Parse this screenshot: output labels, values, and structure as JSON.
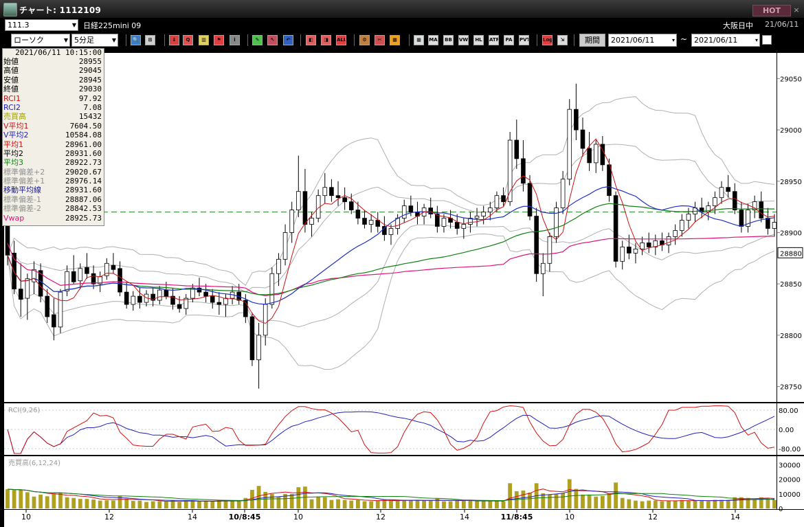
{
  "window": {
    "title": "チャート: 1112109",
    "hot_button": "HOT",
    "close_glyph": "×"
  },
  "toolbar1": {
    "symbol_code": "111.3",
    "symbol_name": "日経225mini 09",
    "session": "大阪日中",
    "session_date": "21/06/11"
  },
  "toolbar2": {
    "chart_type": "ローソク",
    "interval": "5分足",
    "period_button": "期間",
    "date_from": "2021/06/11",
    "date_to": "2021/06/11",
    "tilde": "~",
    "icons": [
      {
        "name": "zoom-icon",
        "label": "🔍",
        "color": "#3a7ec8"
      },
      {
        "name": "split-icon",
        "label": "⊞",
        "color": "#d0d0d0"
      },
      {
        "name": "download-icon",
        "label": "⇓",
        "color": "#d94040"
      },
      {
        "name": "search-chart-icon",
        "label": "Q",
        "color": "#e05050"
      },
      {
        "name": "bar-chart-icon",
        "label": "▥",
        "color": "#e0d060"
      },
      {
        "name": "flag-icon",
        "label": "⚑",
        "color": "#e04040"
      },
      {
        "name": "info-icon",
        "label": "i",
        "color": "#888888"
      },
      {
        "name": "pencil-icon",
        "label": "✎",
        "color": "#50c050"
      },
      {
        "name": "cursor-icon",
        "label": "↖",
        "color": "#c05060"
      },
      {
        "name": "undo-icon",
        "label": "↶",
        "color": "#3060c0"
      },
      {
        "name": "candle-left-icon",
        "label": "◧",
        "color": "#e06060"
      },
      {
        "name": "candle-right-icon",
        "label": "◨",
        "color": "#e06060"
      },
      {
        "name": "all-icon",
        "label": "ALL",
        "color": "#e04040"
      },
      {
        "name": "settings-icon",
        "label": "⚙",
        "color": "#c08040"
      },
      {
        "name": "wrench-icon",
        "label": "✂",
        "color": "#d05050"
      },
      {
        "name": "color-palette-icon",
        "label": "▦",
        "color": "#f0a020"
      },
      {
        "name": "grid-icon",
        "label": "▦",
        "color": "#dddddd"
      },
      {
        "name": "ma-indicator-icon",
        "label": "MA",
        "color": "#dddddd"
      },
      {
        "name": "bb-indicator-icon",
        "label": "BB",
        "color": "#dddddd"
      },
      {
        "name": "vwap-indicator-icon",
        "label": "VWE",
        "color": "#dddddd"
      },
      {
        "name": "hl-indicator-icon",
        "label": "HL",
        "color": "#dddddd"
      },
      {
        "name": "atr-indicator-icon",
        "label": "ATR",
        "color": "#dddddd"
      },
      {
        "name": "pa-indicator-icon",
        "label": "PA",
        "color": "#dddddd"
      },
      {
        "name": "pvt-indicator-icon",
        "label": "PVT",
        "color": "#dddddd"
      },
      {
        "name": "log-scale-icon",
        "label": "Log",
        "color": "#e04040"
      },
      {
        "name": "export-icon",
        "label": "⇲",
        "color": "#dddddd"
      }
    ]
  },
  "info_panel": {
    "datetime": "2021/06/11 10:15:00",
    "rows": [
      {
        "label": "始値",
        "value": "28955",
        "color": "#000000"
      },
      {
        "label": "高値",
        "value": "29045",
        "color": "#000000"
      },
      {
        "label": "安値",
        "value": "28945",
        "color": "#000000"
      },
      {
        "label": "終値",
        "value": "29030",
        "color": "#000000"
      },
      {
        "label": "RCI1",
        "value": "97.92",
        "color": "#d01010"
      },
      {
        "label": "RCI2",
        "value": "7.08",
        "color": "#2020c0"
      },
      {
        "label": "売買高",
        "value": "15432",
        "color": "#a0a000"
      },
      {
        "label": "V平均1",
        "value": "7604.50",
        "color": "#d01010"
      },
      {
        "label": "V平均2",
        "value": "10584.08",
        "color": "#2020c0"
      },
      {
        "label": "平均1",
        "value": "28961.00",
        "color": "#d01010"
      },
      {
        "label": "平均2",
        "value": "28931.60",
        "color": "#000000"
      },
      {
        "label": "平均3",
        "value": "28922.73",
        "color": "#108010"
      },
      {
        "label": "標準偏差+2",
        "value": "29020.67",
        "color": "#909090"
      },
      {
        "label": "標準偏差+1",
        "value": "28976.14",
        "color": "#909090"
      },
      {
        "label": "移動平均線",
        "value": "28931.60",
        "color": "#1a1a90"
      },
      {
        "label": "標準偏差-1",
        "value": "28887.06",
        "color": "#909090"
      },
      {
        "label": "標準偏差-2",
        "value": "28842.53",
        "color": "#909090"
      },
      {
        "label": "Vwap",
        "value": "28925.73",
        "color": "#e0107a"
      }
    ]
  },
  "chart_data": {
    "type": "candlestick",
    "price_axis": {
      "min": 28735,
      "max": 29075,
      "ticks": [
        "29050",
        "29000",
        "28950",
        "28900",
        "28850",
        "28800",
        "28750"
      ],
      "current_price_label": "28880"
    },
    "rci_axis": {
      "label": "RCI(9,26)",
      "ticks": [
        "80.00",
        "0.00",
        "-80.00"
      ]
    },
    "volume_axis": {
      "label": "売買高(6,12,24)",
      "ticks": [
        "30000",
        "20000",
        "10000",
        "0"
      ]
    },
    "x_tick_labels": [
      "10",
      "12",
      "14",
      "10/8:45",
      "10",
      "12",
      "14",
      "11/8:45",
      "10",
      "12",
      "14"
    ],
    "reference_price": 28920,
    "candles": [
      [
        28912,
        28922,
        28868,
        28878
      ],
      [
        28880,
        28892,
        28840,
        28845
      ],
      [
        28845,
        28870,
        28818,
        28835
      ],
      [
        28836,
        28860,
        28815,
        28855
      ],
      [
        28852,
        28872,
        28840,
        28864
      ],
      [
        28863,
        28870,
        28832,
        28838
      ],
      [
        28838,
        28845,
        28812,
        28818
      ],
      [
        28820,
        28836,
        28795,
        28808
      ],
      [
        28808,
        28845,
        28802,
        28842
      ],
      [
        28843,
        28868,
        28838,
        28862
      ],
      [
        28862,
        28878,
        28850,
        28852
      ],
      [
        28853,
        28870,
        28845,
        28865
      ],
      [
        28866,
        28880,
        28855,
        28860
      ],
      [
        28860,
        28868,
        28845,
        28850
      ],
      [
        28850,
        28862,
        28842,
        28857
      ],
      [
        28858,
        28875,
        28854,
        28870
      ],
      [
        28868,
        28880,
        28860,
        28864
      ],
      [
        28865,
        28872,
        28838,
        28842
      ],
      [
        28842,
        28852,
        28826,
        28830
      ],
      [
        28830,
        28843,
        28824,
        28838
      ],
      [
        28838,
        28846,
        28826,
        28832
      ],
      [
        28832,
        28844,
        28828,
        28840
      ],
      [
        28840,
        28846,
        28828,
        28834
      ],
      [
        28834,
        28848,
        28830,
        28844
      ],
      [
        28844,
        28852,
        28835,
        28838
      ],
      [
        28838,
        28846,
        28825,
        28830
      ],
      [
        28830,
        28838,
        28822,
        28826
      ],
      [
        28826,
        28840,
        28820,
        28836
      ],
      [
        28836,
        28850,
        28832,
        28846
      ],
      [
        28846,
        28856,
        28838,
        28842
      ],
      [
        28842,
        28850,
        28832,
        28838
      ],
      [
        28838,
        28845,
        28826,
        28832
      ],
      [
        28832,
        28842,
        28820,
        28830
      ],
      [
        28830,
        28840,
        28818,
        28836
      ],
      [
        28836,
        28848,
        28830,
        28842
      ],
      [
        28842,
        28850,
        28830,
        28834
      ],
      [
        28834,
        28840,
        28812,
        28818
      ],
      [
        28818,
        28822,
        28770,
        28776
      ],
      [
        28776,
        28812,
        28748,
        28800
      ],
      [
        28800,
        28836,
        28790,
        28830
      ],
      [
        28830,
        28866,
        28826,
        28860
      ],
      [
        28860,
        28880,
        28848,
        28874
      ],
      [
        28874,
        28908,
        28868,
        28900
      ],
      [
        28900,
        28930,
        28890,
        28922
      ],
      [
        28922,
        28975,
        28915,
        28940
      ],
      [
        28940,
        28962,
        28900,
        28908
      ],
      [
        28908,
        28920,
        28896,
        28914
      ],
      [
        28914,
        28942,
        28910,
        28936
      ],
      [
        28936,
        28958,
        28928,
        28944
      ],
      [
        28944,
        28952,
        28930,
        28936
      ],
      [
        28936,
        28950,
        28926,
        28934
      ],
      [
        28934,
        28944,
        28922,
        28930
      ],
      [
        28930,
        28938,
        28918,
        28922
      ],
      [
        28922,
        28930,
        28908,
        28914
      ],
      [
        28914,
        28922,
        28904,
        28908
      ],
      [
        28908,
        28918,
        28900,
        28912
      ],
      [
        28912,
        28920,
        28900,
        28906
      ],
      [
        28906,
        28916,
        28892,
        28898
      ],
      [
        28898,
        28908,
        28888,
        28904
      ],
      [
        28904,
        28918,
        28898,
        28914
      ],
      [
        28914,
        28932,
        28910,
        28926
      ],
      [
        28926,
        28936,
        28916,
        28920
      ],
      [
        28920,
        28930,
        28908,
        28916
      ],
      [
        28916,
        28928,
        28908,
        28924
      ],
      [
        28924,
        28934,
        28914,
        28918
      ],
      [
        28918,
        28926,
        28900,
        28906
      ],
      [
        28906,
        28918,
        28900,
        28914
      ],
      [
        28914,
        28922,
        28904,
        28910
      ],
      [
        28910,
        28918,
        28898,
        28904
      ],
      [
        28904,
        28914,
        28894,
        28908
      ],
      [
        28908,
        28920,
        28900,
        28914
      ],
      [
        28914,
        28924,
        28906,
        28916
      ],
      [
        28916,
        28926,
        28908,
        28920
      ],
      [
        28920,
        28930,
        28912,
        28924
      ],
      [
        28924,
        28940,
        28920,
        28936
      ],
      [
        28936,
        28944,
        28926,
        28930
      ],
      [
        28930,
        28998,
        28926,
        28990
      ],
      [
        28990,
        29010,
        28962,
        28972
      ],
      [
        28972,
        28990,
        28940,
        28948
      ],
      [
        28948,
        28956,
        28912,
        28916
      ],
      [
        28916,
        28924,
        28852,
        28860
      ],
      [
        28860,
        28880,
        28838,
        28870
      ],
      [
        28870,
        28900,
        28862,
        28896
      ],
      [
        28896,
        28930,
        28890,
        28924
      ],
      [
        28924,
        28960,
        28918,
        28952
      ],
      [
        28952,
        29030,
        28946,
        29020
      ],
      [
        29020,
        29045,
        28990,
        29000
      ],
      [
        29000,
        29012,
        28974,
        28982
      ],
      [
        28982,
        28998,
        28960,
        28968
      ],
      [
        28968,
        28990,
        28958,
        28986
      ],
      [
        28986,
        28994,
        28960,
        28966
      ],
      [
        28966,
        28972,
        28930,
        28936
      ],
      [
        28936,
        28940,
        28866,
        28872
      ],
      [
        28872,
        28892,
        28864,
        28886
      ],
      [
        28886,
        28898,
        28874,
        28880
      ],
      [
        28880,
        28890,
        28870,
        28884
      ],
      [
        28884,
        28896,
        28878,
        28890
      ],
      [
        28890,
        28900,
        28880,
        28886
      ],
      [
        28886,
        28898,
        28878,
        28892
      ],
      [
        28892,
        28900,
        28882,
        28888
      ],
      [
        28888,
        28900,
        28880,
        28896
      ],
      [
        28896,
        28908,
        28888,
        28902
      ],
      [
        28902,
        28918,
        28896,
        28912
      ],
      [
        28912,
        28924,
        28904,
        28918
      ],
      [
        28918,
        28930,
        28910,
        28924
      ],
      [
        28924,
        28934,
        28914,
        28920
      ],
      [
        28920,
        28930,
        28912,
        28926
      ],
      [
        28926,
        28940,
        28918,
        28934
      ],
      [
        28934,
        28950,
        28928,
        28944
      ],
      [
        28944,
        28956,
        28934,
        28940
      ],
      [
        28940,
        28948,
        28918,
        28922
      ],
      [
        28922,
        28930,
        28900,
        28906
      ],
      [
        28906,
        28928,
        28900,
        28922
      ],
      [
        28922,
        28936,
        28914,
        28930
      ],
      [
        28930,
        28940,
        28910,
        28914
      ],
      [
        28914,
        28924,
        28898,
        28904
      ],
      [
        28904,
        28918,
        28896,
        28910
      ]
    ]
  }
}
